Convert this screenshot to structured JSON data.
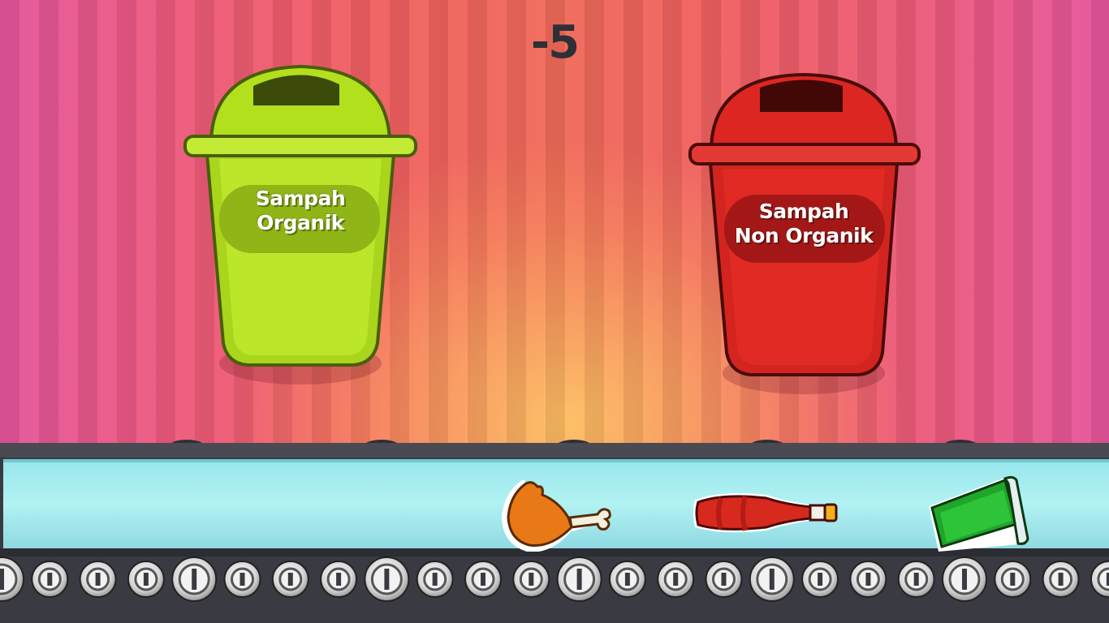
{
  "score": "-5",
  "bins": [
    {
      "label_line1": "Sampah",
      "label_line2": "Organik",
      "color": "#b5e21f"
    },
    {
      "label_line1": "Sampah",
      "label_line2": "Non Organik",
      "color": "#e02a23"
    }
  ],
  "conveyor": {
    "belt_color": "#a8eef2"
  },
  "items": [
    {
      "name": "chicken-leg",
      "category": "organic"
    },
    {
      "name": "sauce-bottle",
      "category": "non-organic"
    },
    {
      "name": "plastic-cup",
      "category": "non-organic"
    }
  ]
}
